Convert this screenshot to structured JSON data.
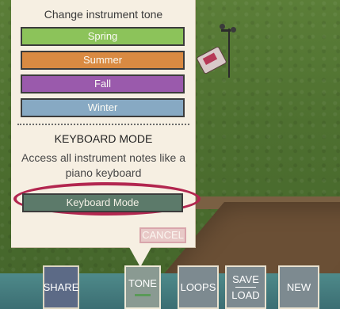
{
  "tone_menu": {
    "title": "Change instrument tone",
    "options": [
      {
        "label": "Spring",
        "color": "#8cc35a"
      },
      {
        "label": "Summer",
        "color": "#d98a42"
      },
      {
        "label": "Fall",
        "color": "#9a5aac"
      },
      {
        "label": "Winter",
        "color": "#87a9c3"
      }
    ]
  },
  "keyboard_mode": {
    "title": "KEYBOARD MODE",
    "description": "Access all instrument notes like a piano keyboard",
    "button_label": "Keyboard Mode",
    "highlight_color": "#b2264f"
  },
  "cancel_label": "CANCEL",
  "toolbar": {
    "share": "SHARE",
    "tone": "TONE",
    "loops": "LOOPS",
    "save": "SAVE",
    "load": "LOAD",
    "new": "NEW"
  }
}
